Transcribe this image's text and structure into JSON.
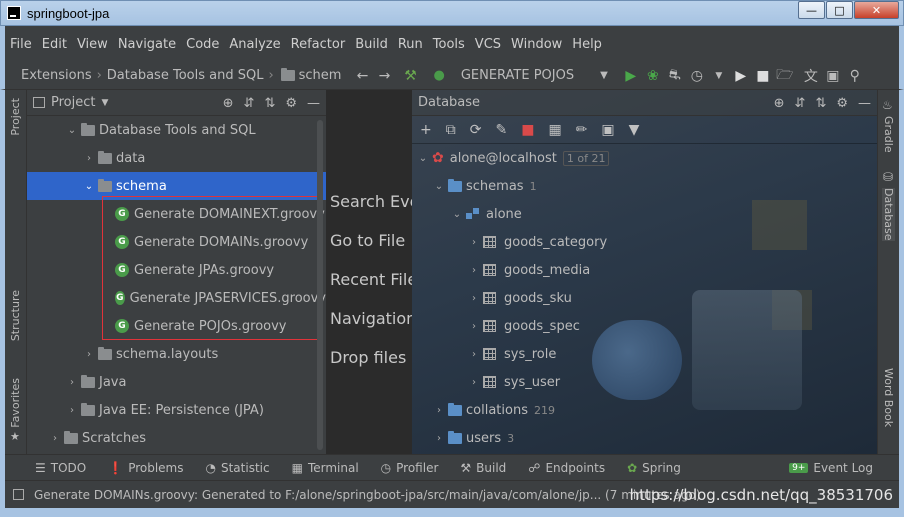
{
  "window": {
    "title": "springboot-jpa"
  },
  "menu": [
    "File",
    "Edit",
    "View",
    "Navigate",
    "Code",
    "Analyze",
    "Refactor",
    "Build",
    "Run",
    "Tools",
    "VCS",
    "Window",
    "Help"
  ],
  "breadcrumb": {
    "items": [
      "Extensions",
      "Database Tools and SQL",
      "schem"
    ]
  },
  "run_config": {
    "label": "GENERATE POJOS"
  },
  "left_strip": {
    "project": "Project",
    "structure": "Structure",
    "favorites": "Favorites"
  },
  "right_strip": {
    "gradle": "Gradle",
    "database": "Database",
    "wordbook": "Word Book"
  },
  "project_panel": {
    "title": "Project",
    "tree": [
      {
        "label": "Database Tools and SQL",
        "level": 2,
        "expanded": true
      },
      {
        "label": "data",
        "level": 3
      },
      {
        "label": "schema",
        "level": 3,
        "expanded": true,
        "selected": true
      },
      {
        "label": "Generate DOMAINEXT.groovy",
        "level": 4,
        "groovy": true
      },
      {
        "label": "Generate DOMAINs.groovy",
        "level": 4,
        "groovy": true
      },
      {
        "label": "Generate JPAs.groovy",
        "level": 4,
        "groovy": true
      },
      {
        "label": "Generate JPASERVICES.groovy",
        "level": 4,
        "groovy": true
      },
      {
        "label": "Generate POJOs.groovy",
        "level": 4,
        "groovy": true
      },
      {
        "label": "schema.layouts",
        "level": 3
      },
      {
        "label": "Java",
        "level": 2
      },
      {
        "label": "Java EE: Persistence (JPA)",
        "level": 2
      },
      {
        "label": "Scratches",
        "level": 1
      }
    ]
  },
  "editor_hints": [
    "Search Eve",
    "Go to File",
    "Recent File",
    "Navigation",
    "Drop files h"
  ],
  "database_panel": {
    "title": "Database",
    "datasource": {
      "label": "alone@localhost",
      "pager": "1 of 21"
    },
    "schemas": {
      "label": "schemas",
      "count": "1"
    },
    "schema": {
      "label": "alone"
    },
    "tables": [
      "goods_category",
      "goods_media",
      "goods_sku",
      "goods_spec",
      "sys_role",
      "sys_user"
    ],
    "collations": {
      "label": "collations",
      "count": "219"
    },
    "users": {
      "label": "users",
      "count": "3"
    }
  },
  "tool_windows": [
    "TODO",
    "Problems",
    "Statistic",
    "Terminal",
    "Profiler",
    "Build",
    "Endpoints",
    "Spring"
  ],
  "event_log": {
    "label": "Event Log",
    "badge": "9+"
  },
  "status": {
    "message": "Generate DOMAINs.groovy: Generated to F:/alone/springboot-jpa/src/main/java/com/alone/jp... (7 minutes ago)",
    "watermark": "https://blog.csdn.net/qq_38531706"
  }
}
